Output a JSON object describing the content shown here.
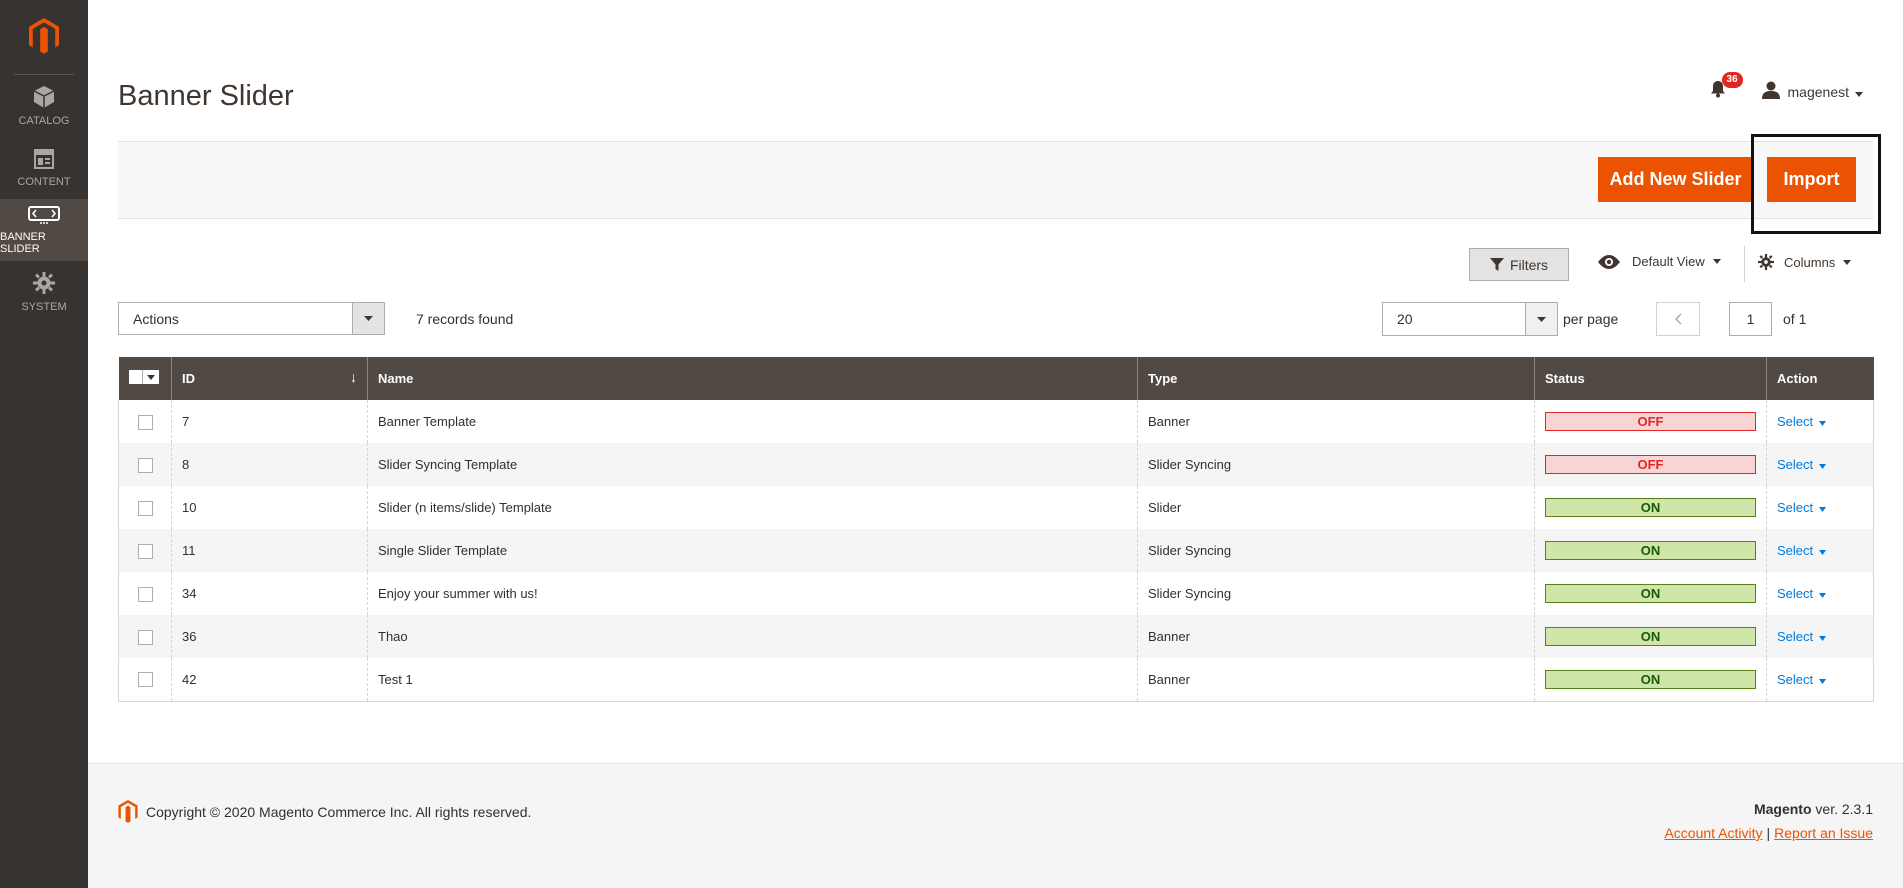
{
  "sidebar": {
    "items": [
      {
        "label": "CATALOG",
        "icon": "cube-icon"
      },
      {
        "label": "CONTENT",
        "icon": "layout-icon"
      },
      {
        "label": "BANNER SLIDER",
        "icon": "slider-icon"
      },
      {
        "label": "SYSTEM",
        "icon": "gear-icon"
      }
    ]
  },
  "header": {
    "title": "Banner Slider",
    "notification_count": "36",
    "username": "magenest"
  },
  "actions": {
    "add_label": "Add New Slider",
    "import_label": "Import"
  },
  "toolbar": {
    "filters_label": "Filters",
    "view_label": "Default View",
    "columns_label": "Columns",
    "actions_label": "Actions",
    "records_found": "7 records found",
    "per_page_value": "20",
    "per_page_label": "per page",
    "current_page": "1",
    "page_total": "of 1"
  },
  "grid": {
    "columns": [
      "ID",
      "Name",
      "Type",
      "Status",
      "Action"
    ],
    "rows": [
      {
        "id": "7",
        "name": "Banner Template",
        "type": "Banner",
        "status": "OFF",
        "action": "Select"
      },
      {
        "id": "8",
        "name": "Slider Syncing Template",
        "type": "Slider Syncing",
        "status": "OFF",
        "action": "Select"
      },
      {
        "id": "10",
        "name": "Slider (n items/slide) Template",
        "type": "Slider",
        "status": "ON",
        "action": "Select"
      },
      {
        "id": "11",
        "name": "Single Slider Template",
        "type": "Slider Syncing",
        "status": "ON",
        "action": "Select"
      },
      {
        "id": "34",
        "name": "Enjoy your summer with us!",
        "type": "Slider Syncing",
        "status": "ON",
        "action": "Select"
      },
      {
        "id": "36",
        "name": "Thao",
        "type": "Banner",
        "status": "ON",
        "action": "Select"
      },
      {
        "id": "42",
        "name": "Test 1",
        "type": "Banner",
        "status": "ON",
        "action": "Select"
      }
    ]
  },
  "footer": {
    "copyright": "Copyright © 2020 Magento Commerce Inc. All rights reserved.",
    "brand": "Magento",
    "version": " ver. 2.3.1",
    "account_activity": "Account Activity",
    "separator": "|",
    "report_issue": "Report an Issue"
  },
  "colors": {
    "accent": "#eb5202",
    "sidebar": "#373330",
    "grid_header": "#514943",
    "link": "#007bdb"
  }
}
